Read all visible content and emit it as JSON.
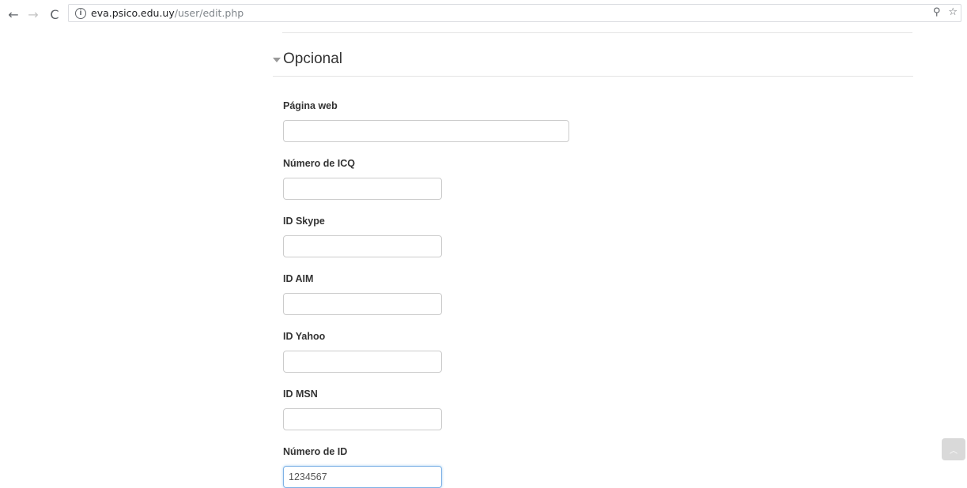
{
  "browser": {
    "back_icon": "←",
    "forward_icon": "→",
    "reload_icon": "C",
    "info_icon": "i",
    "url_host": "eva.psico.edu.uy",
    "url_path": "/user/edit.php",
    "key_icon": "⚲",
    "star_icon": "☆"
  },
  "form": {
    "section_title": "Opcional",
    "fields": [
      {
        "label": "Página web",
        "value": "",
        "width": "wide"
      },
      {
        "label": "Número de ICQ",
        "value": "",
        "width": "narrow"
      },
      {
        "label": "ID Skype",
        "value": "",
        "width": "narrow"
      },
      {
        "label": "ID AIM",
        "value": "",
        "width": "narrow"
      },
      {
        "label": "ID Yahoo",
        "value": "",
        "width": "narrow"
      },
      {
        "label": "ID MSN",
        "value": "",
        "width": "narrow"
      },
      {
        "label": "Número de ID",
        "value": "1234567",
        "width": "narrow",
        "focused": true
      }
    ]
  },
  "scroll_top_icon": "︿"
}
